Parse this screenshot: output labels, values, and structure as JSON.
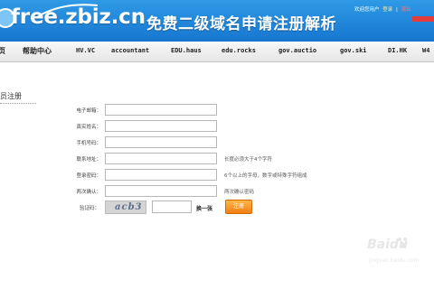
{
  "header": {
    "logo": "free.zbiz.cn",
    "slogan": "免费二级域名申请注册解析",
    "links": {
      "welcome": "欢迎您用户",
      "login": "登录",
      "separator": "|",
      "logout": "退出"
    }
  },
  "nav": {
    "items": [
      {
        "label": "页"
      },
      {
        "label": "帮助中心"
      },
      {
        "label": "HV.VC"
      },
      {
        "label": "accountant"
      },
      {
        "label": "EDU.haus"
      },
      {
        "label": "edu.rocks"
      },
      {
        "label": "gov.auctio"
      },
      {
        "label": "gov.ski"
      },
      {
        "label": "DI.HK"
      },
      {
        "label": "W4"
      }
    ]
  },
  "form": {
    "section_title": "员注册",
    "fields": [
      {
        "label": "电子邮箱：",
        "value": ""
      },
      {
        "label": "真实姓名：",
        "value": ""
      },
      {
        "label": "手机号码：",
        "value": ""
      },
      {
        "label": "联系地址：",
        "value": ""
      },
      {
        "label": "登录密码：",
        "value": ""
      },
      {
        "label": "两次确认：",
        "value": ""
      }
    ],
    "hints": {
      "address": "长度必须大于4个字符",
      "password": "6个以上的字母，数字或特殊字符组成",
      "confirm": "两次确认密码"
    },
    "captcha_label": "验证码：",
    "captcha_text": "acb3",
    "captcha_value": "",
    "refresh_label": "换一张",
    "submit_label": "注册"
  },
  "watermark": {
    "brand": "Baidu",
    "subtext": "jingyan.baidu.com"
  },
  "colors": {
    "header_blue": "#1f86db",
    "submit_orange": "#f39224",
    "logout_red": "#e43b3b"
  }
}
